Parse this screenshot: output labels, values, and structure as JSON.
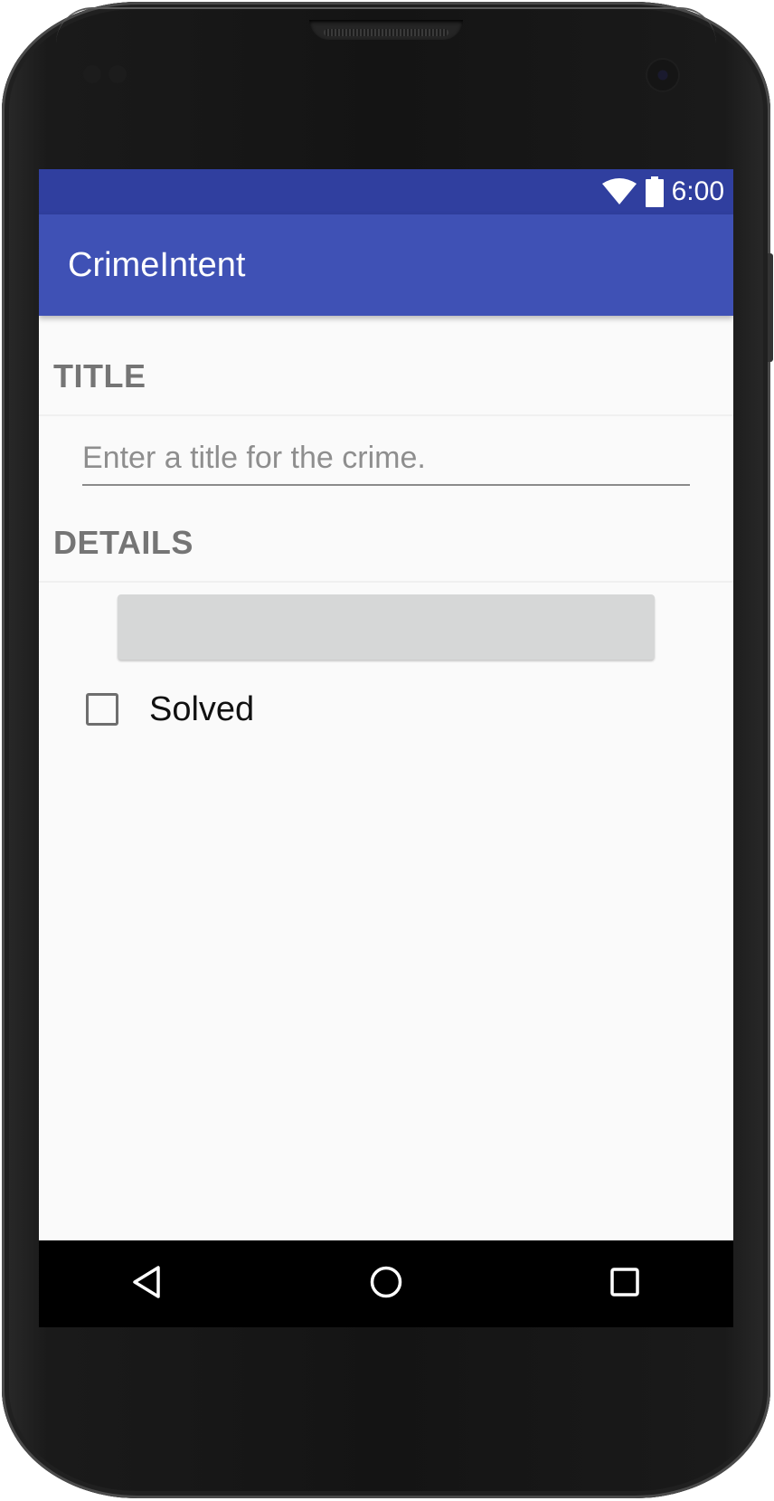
{
  "device": {
    "frame": "android-phone"
  },
  "status_bar": {
    "time": "6:00",
    "icons": [
      "wifi-icon",
      "battery-icon"
    ],
    "color": "#303f9f"
  },
  "app_bar": {
    "title": "CrimeIntent",
    "color": "#3f51b5"
  },
  "form": {
    "title_section": {
      "header": "TITLE",
      "input_value": "",
      "input_placeholder": "Enter a title for the crime."
    },
    "details_section": {
      "header": "DETAILS",
      "date_button_label": "",
      "solved_label": "Solved",
      "solved_checked": false
    }
  },
  "nav_bar": {
    "buttons": [
      "back-icon",
      "home-icon",
      "recents-icon"
    ]
  },
  "colors": {
    "header_text": "#757575",
    "screen_bg": "#fafafa",
    "button_bg": "#d6d7d7"
  }
}
